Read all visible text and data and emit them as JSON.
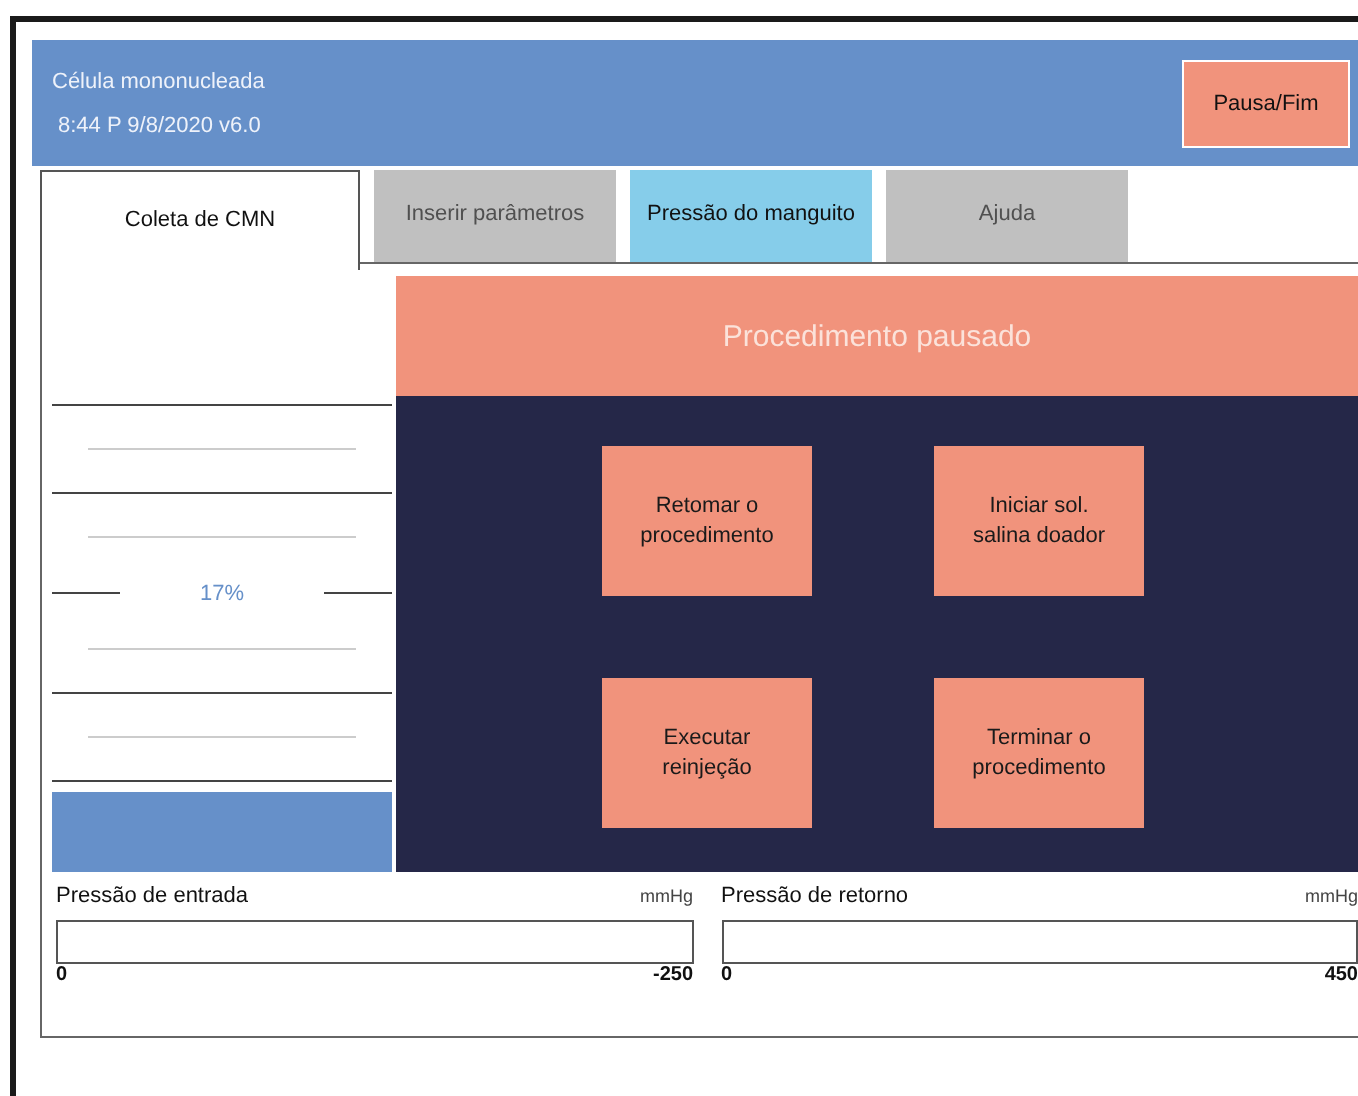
{
  "header": {
    "title": "Célula mononucleada",
    "status": "8:44 P  9/8/2020   v6.0",
    "button": "Pausa/Fim"
  },
  "tabs": [
    {
      "label": "Coleta de CMN",
      "selected": true,
      "disabled": false
    },
    {
      "label": "Inserir parâmetros",
      "selected": false,
      "disabled": true
    },
    {
      "label": "Pressão do manguito",
      "selected": false,
      "disabled": false
    },
    {
      "label": "Ajuda",
      "selected": false,
      "disabled": true
    }
  ],
  "progress": {
    "reading": "17%"
  },
  "panel": {
    "title": "Procedimento pausado",
    "buttons": [
      "Retomar o procedimento",
      "Iniciar sol. salina doador",
      "Executar reinjeção",
      "Terminar o procedimento"
    ]
  },
  "pressures": [
    {
      "label": "Pressão de entrada",
      "unit": "mmHg",
      "level": 0,
      "min": "0",
      "max": "-250"
    },
    {
      "label": "Pressão de retorno",
      "unit": "mmHg",
      "level": 0,
      "min": "0",
      "max": "450"
    }
  ]
}
